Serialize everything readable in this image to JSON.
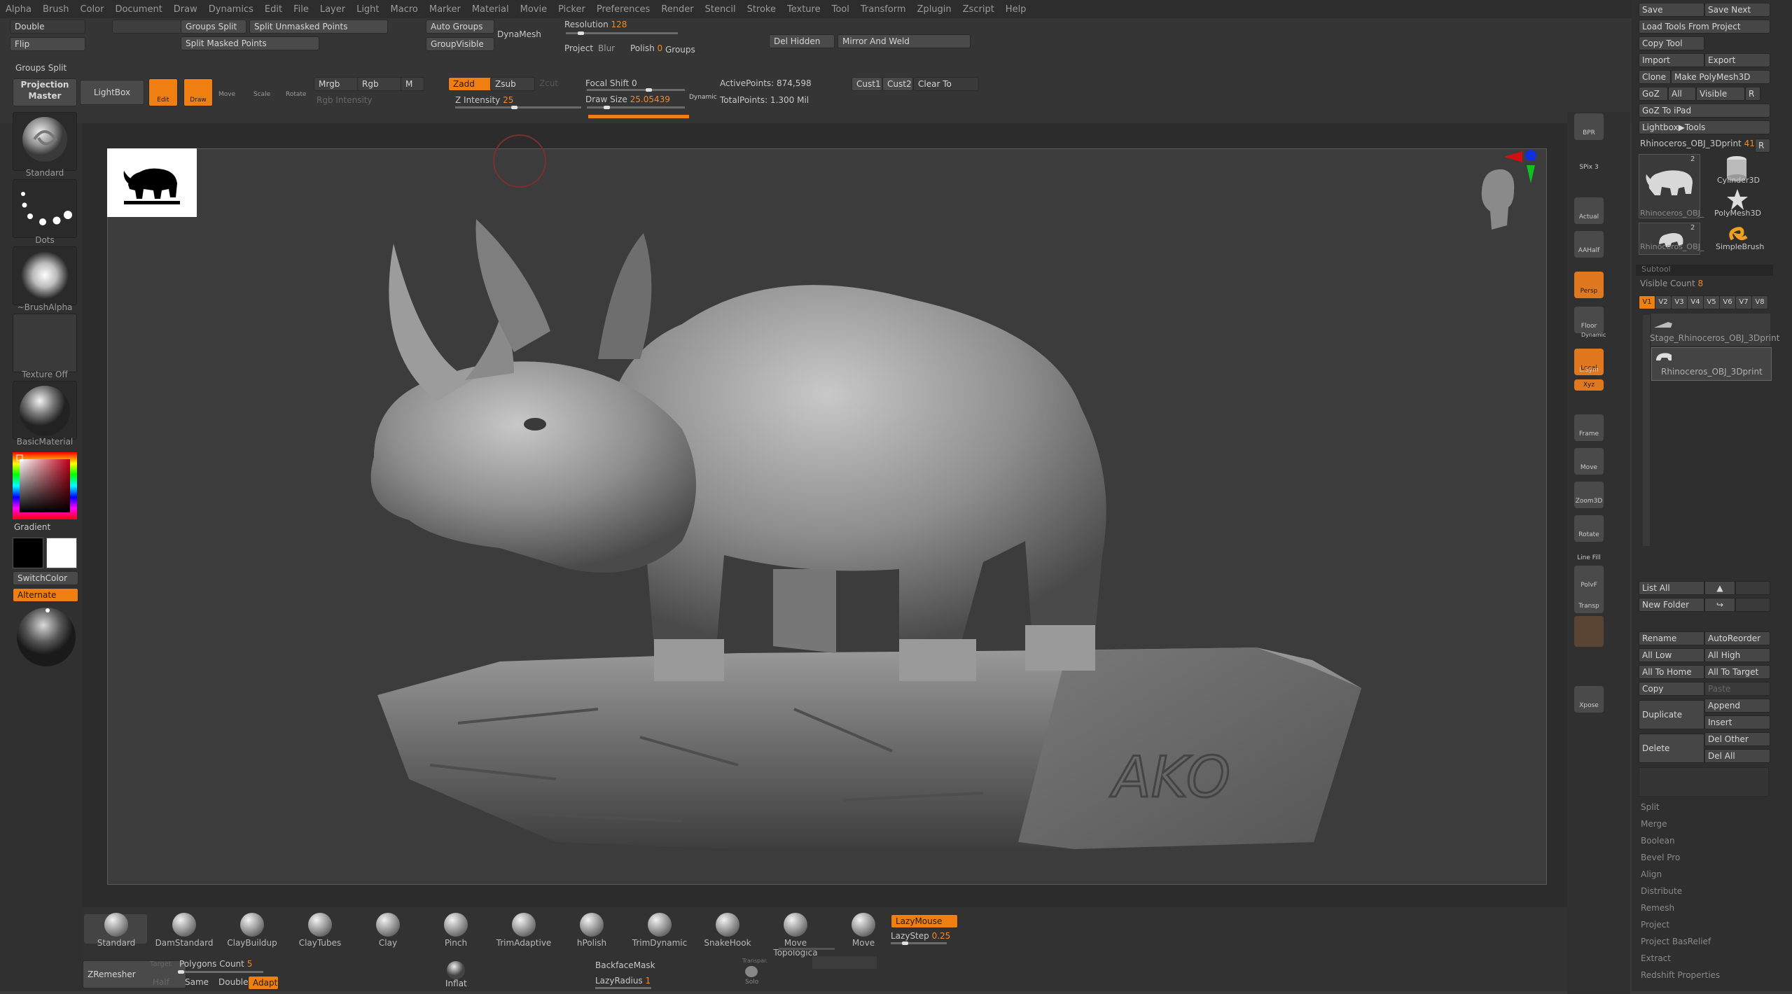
{
  "menu": [
    "Alpha",
    "Brush",
    "Color",
    "Document",
    "Draw",
    "Dynamics",
    "Edit",
    "File",
    "Layer",
    "Light",
    "Macro",
    "Marker",
    "Material",
    "Movie",
    "Picker",
    "Preferences",
    "Render",
    "Stencil",
    "Stroke",
    "Texture",
    "Tool",
    "Transform",
    "Zplugin",
    "Zscript",
    "Help"
  ],
  "top": {
    "double": "Double",
    "flip": "Flip",
    "groups_split": "Groups Split",
    "split_unmasked": "Split Unmasked Points",
    "split_masked": "Split Masked Points",
    "auto_groups": "Auto Groups",
    "group_visible": "GroupVisible",
    "dynamesh": "DynaMesh",
    "resolution_label": "Resolution",
    "resolution_value": "128",
    "project": "Project",
    "blur": "Blur",
    "polish_label": "Polish",
    "polish_value": "0",
    "groups": "Groups",
    "del_hidden": "Del Hidden",
    "mirror_weld": "Mirror And Weld"
  },
  "draw": {
    "groups_split_title": "Groups Split",
    "projection_master": "Projection Master",
    "lightbox": "LightBox",
    "edit": "Edit",
    "draw": "Draw",
    "move": "Move",
    "scale": "Scale",
    "rotate": "Rotate",
    "mrgb": "Mrgb",
    "rgb": "Rgb",
    "m": "M",
    "rgb_intensity": "Rgb Intensity",
    "zadd": "Zadd",
    "zsub": "Zsub",
    "zcut": "Zcut",
    "z_intensity_label": "Z Intensity",
    "z_intensity_value": "25",
    "focal_shift_label": "Focal Shift",
    "focal_shift_value": "0",
    "draw_size_label": "Draw Size",
    "draw_size_value": "25.05439",
    "dynamic": "Dynamic",
    "active_points": "ActivePoints: 874,598",
    "total_points": "TotalPoints: 1.300 Mil",
    "cust1": "Cust1",
    "cust2": "Cust2",
    "clear_to": "Clear To"
  },
  "left": {
    "standard": "Standard",
    "dots": "Dots",
    "brush_alpha": "~BrushAlpha",
    "texture_off": "Texture Off",
    "basic_material": "BasicMaterial",
    "gradient": "Gradient",
    "switch_color": "SwitchColor",
    "alternate": "Alternate"
  },
  "canvas": {
    "stamp_text": "AKO"
  },
  "right_shelf": [
    "BPR",
    "SPix 3",
    "Actual",
    "AAHalf",
    "Persp",
    "Floor",
    "Local",
    "L.Sym",
    "Xyz",
    "Frame",
    "Move",
    "Zoom3D",
    "Rotate",
    "Line Fill",
    "PolyF",
    "Transp",
    "Xpose"
  ],
  "right_shelf_labels": {
    "dynamic1": "Dynamic",
    "dynamic2": "Dynamic"
  },
  "panel": {
    "save": "Save",
    "save_next": "Save Next",
    "load_tools": "Load Tools From Project",
    "copy_tool": "Copy Tool",
    "import": "Import",
    "export": "Export",
    "clone": "Clone",
    "make_polymesh": "Make PolyMesh3D",
    "goz": "GoZ",
    "all": "All",
    "visible": "Visible",
    "r": "R",
    "goz_ipad": "GoZ To iPad",
    "lightbox_tools": "Lightbox▶Tools",
    "current_tool": "Rhinoceros_OBJ_3Dprint",
    "current_tool_count": "41",
    "tool_r": "R",
    "tools": [
      {
        "name": "Rhinoceros_OBJ_",
        "count": "2"
      },
      {
        "name": "Cylinder3D",
        "count": ""
      },
      {
        "name": "PolyMesh3D",
        "count": ""
      },
      {
        "name": "Rhinoceros_OBJ_",
        "count": "2"
      },
      {
        "name": "SimpleBrush",
        "count": ""
      }
    ],
    "subtool_title": "Subtool",
    "visible_count_label": "Visible Count",
    "visible_count_value": "8",
    "v_tabs": [
      "V1",
      "V2",
      "V3",
      "V4",
      "V5",
      "V6",
      "V7",
      "V8"
    ],
    "subtools": [
      "Stage_Rhinoceros_OBJ_3Dprint",
      "Rhinoceros_OBJ_3Dprint"
    ],
    "list_all": "List All",
    "new_folder": "New Folder",
    "rename": "Rename",
    "auto_reorder": "AutoReorder",
    "all_low": "All Low",
    "all_high": "All High",
    "all_to_home": "All To Home",
    "all_to_target": "All To Target",
    "copy": "Copy",
    "paste": "Paste",
    "duplicate": "Duplicate",
    "append": "Append",
    "insert": "Insert",
    "delete": "Delete",
    "del_other": "Del Other",
    "del_all": "Del All",
    "sections": [
      "Split",
      "Merge",
      "Boolean",
      "Bevel Pro",
      "Align",
      "Distribute",
      "Remesh",
      "Project",
      "Project BasRelief",
      "Extract",
      "Redshift Properties"
    ]
  },
  "bottom": {
    "brushes": [
      "Standard",
      "DamStandard",
      "ClayBuildup",
      "ClayTubes",
      "Clay",
      "Pinch",
      "TrimAdaptive",
      "hPolish",
      "TrimDynamic",
      "SnakeHook",
      "Move Topologica",
      "Move"
    ],
    "lazymouse": "LazyMouse",
    "lazystep_label": "LazyStep",
    "lazystep_value": "0.25",
    "zremesher": "ZRemesher",
    "target_label": "Target",
    "polygons_count_label": "Polygons Count",
    "polygons_count_value": "5",
    "half": "Half",
    "same": "Same",
    "double": "Double",
    "adapt": "Adapt",
    "inflat": "Inflat",
    "backface_mask": "BackfaceMask",
    "lazyradius_label": "LazyRadius",
    "lazyradius_value": "1",
    "solo_top": "Transpar.",
    "solo": "Solo"
  }
}
